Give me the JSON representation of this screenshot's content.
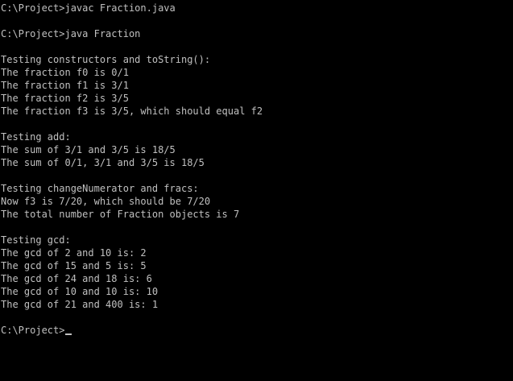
{
  "console": {
    "text_color": "#c0c0c0",
    "background_color": "#000000",
    "lines": [
      "C:\\Project>javac Fraction.java",
      "",
      "C:\\Project>java Fraction",
      "",
      "Testing constructors and toString():",
      "The fraction f0 is 0/1",
      "The fraction f1 is 3/1",
      "The fraction f2 is 3/5",
      "The fraction f3 is 3/5, which should equal f2",
      "",
      "Testing add:",
      "The sum of 3/1 and 3/5 is 18/5",
      "The sum of 0/1, 3/1 and 3/5 is 18/5",
      "",
      "Testing changeNumerator and fracs:",
      "Now f3 is 7/20, which should be 7/20",
      "The total number of Fraction objects is 7",
      "",
      "Testing gcd:",
      "The gcd of 2 and 10 is: 2",
      "The gcd of 15 and 5 is: 5",
      "The gcd of 24 and 18 is: 6",
      "The gcd of 10 and 10 is: 10",
      "The gcd of 21 and 400 is: 1",
      "",
      "C:\\Project>"
    ]
  }
}
